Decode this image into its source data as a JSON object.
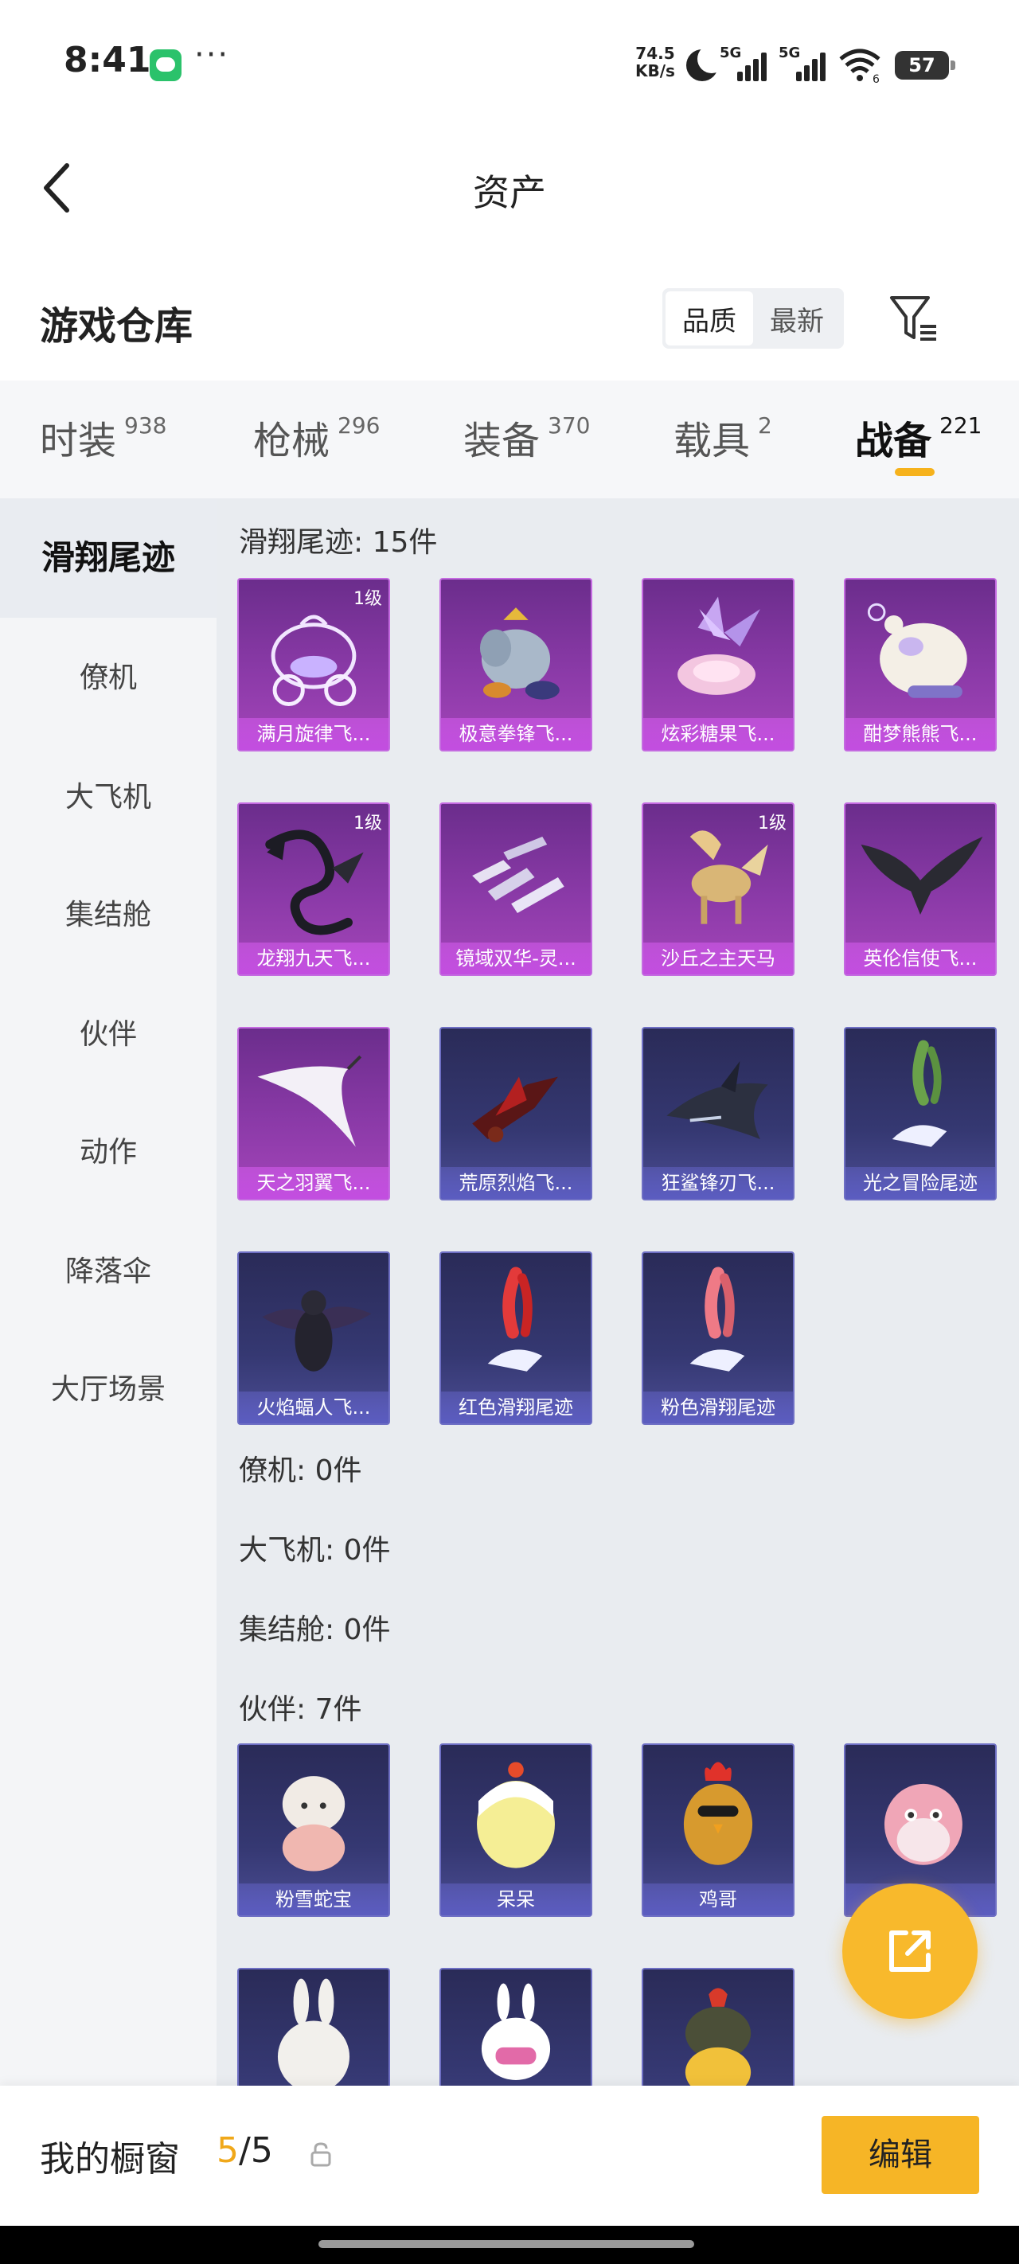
{
  "status_bar": {
    "time": "8:41",
    "more": "···",
    "speed_value": "74.5",
    "speed_unit": "KB/s",
    "signal1_label": "5G",
    "signal2_label": "5G",
    "wifi_badge": "6",
    "battery": "57"
  },
  "header": {
    "title": "资产",
    "back_icon": "chevron-left-icon"
  },
  "warehouse": {
    "title": "游戏仓库",
    "sort_options": [
      "品质",
      "最新"
    ],
    "sort_selected": "品质",
    "filter_icon": "filter-icon"
  },
  "tabs": [
    {
      "label": "时装",
      "count": "938"
    },
    {
      "label": "枪械",
      "count": "296"
    },
    {
      "label": "装备",
      "count": "370"
    },
    {
      "label": "载具",
      "count": "2"
    },
    {
      "label": "战备",
      "count": "221",
      "active": true
    }
  ],
  "sidebar": {
    "items": [
      "滑翔尾迹",
      "僚机",
      "大飞机",
      "集结舱",
      "伙伴",
      "动作",
      "降落伞",
      "大厅场景"
    ],
    "active": "滑翔尾迹"
  },
  "sections": {
    "glide_trail": {
      "title": "滑翔尾迹: 15件",
      "items": [
        {
          "name": "满月旋律飞...",
          "level": "1级",
          "rarity": "purple"
        },
        {
          "name": "极意拳锋飞...",
          "level": "",
          "rarity": "purple"
        },
        {
          "name": "炫彩糖果飞...",
          "level": "",
          "rarity": "purple"
        },
        {
          "name": "酣梦熊熊飞...",
          "level": "",
          "rarity": "purple"
        },
        {
          "name": "龙翔九天飞...",
          "level": "1级",
          "rarity": "purple"
        },
        {
          "name": "镜域双华-灵...",
          "level": "",
          "rarity": "purple"
        },
        {
          "name": "沙丘之主天马",
          "level": "1级",
          "rarity": "purple"
        },
        {
          "name": "英伦信使飞...",
          "level": "",
          "rarity": "purple"
        },
        {
          "name": "天之羽翼飞...",
          "level": "",
          "rarity": "purple"
        },
        {
          "name": "荒原烈焰飞...",
          "level": "",
          "rarity": "blue"
        },
        {
          "name": "狂鲨锋刃飞...",
          "level": "",
          "rarity": "blue"
        },
        {
          "name": "光之冒险尾迹",
          "level": "",
          "rarity": "blue"
        },
        {
          "name": "火焰蝠人飞...",
          "level": "",
          "rarity": "blue"
        },
        {
          "name": "红色滑翔尾迹",
          "level": "",
          "rarity": "blue"
        },
        {
          "name": "粉色滑翔尾迹",
          "level": "",
          "rarity": "blue"
        }
      ]
    },
    "wingman": {
      "title": "僚机: 0件"
    },
    "big_plane": {
      "title": "大飞机: 0件"
    },
    "assembly_pod": {
      "title": "集结舱: 0件"
    },
    "partner": {
      "title": "伙伴: 7件",
      "items": [
        {
          "name": "粉雪蛇宝",
          "rarity": "blue"
        },
        {
          "name": "呆呆",
          "rarity": "blue"
        },
        {
          "name": "鸡哥",
          "rarity": "blue"
        },
        {
          "name": "",
          "rarity": "blue"
        },
        {
          "name": "",
          "rarity": "blue"
        },
        {
          "name": "",
          "rarity": "blue"
        },
        {
          "name": "",
          "rarity": "blue"
        }
      ]
    }
  },
  "fab": {
    "icon": "share-external-icon"
  },
  "bottom_bar": {
    "label": "我的橱窗",
    "current": "5",
    "separator": "/",
    "total": "5",
    "lock_icon": "lock-icon",
    "edit_label": "编辑"
  }
}
